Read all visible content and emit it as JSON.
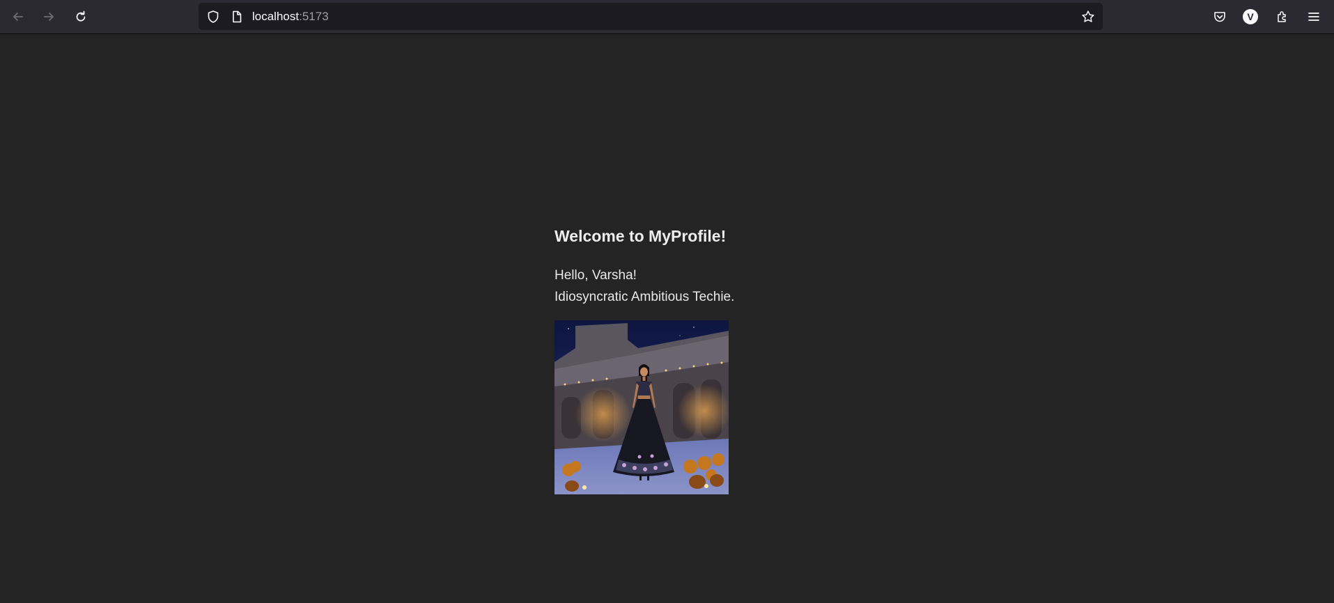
{
  "browser": {
    "url_host": "localhost",
    "url_port": ":5173",
    "account_initial": "V",
    "icons": [
      "back-arrow-icon",
      "forward-arrow-icon",
      "reload-icon",
      "shield-icon",
      "page-icon",
      "star-icon",
      "pocket-icon",
      "extensions-icon",
      "hamburger-menu-icon"
    ]
  },
  "page": {
    "title": "Welcome to MyProfile!",
    "greeting": "Hello, Varsha!",
    "tagline": "Idiosyncratic Ambitious Techie.",
    "image_alt": "Profile illustration"
  },
  "colors": {
    "background": "#242424",
    "toolbar": "#2b2a33",
    "urlbar": "#1c1b22",
    "text": "#e8e8e8"
  }
}
